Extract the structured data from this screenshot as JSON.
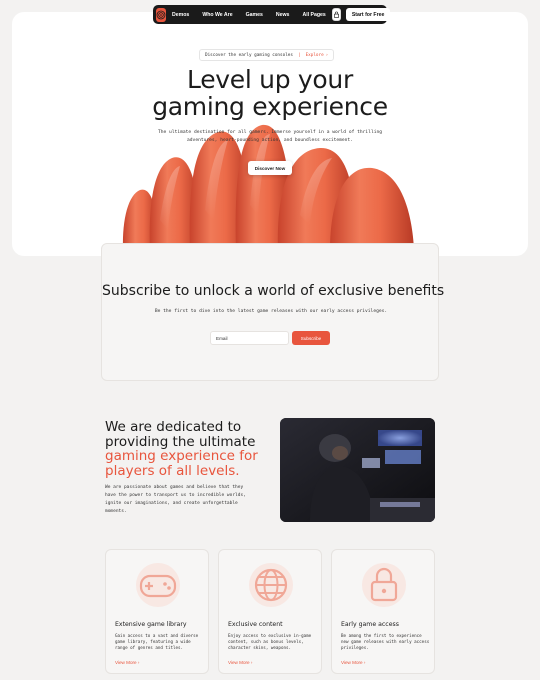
{
  "nav": {
    "links": [
      "Demos",
      "Who We Are",
      "Games",
      "News",
      "All Pages"
    ],
    "cta": "Start for Free"
  },
  "hero": {
    "pill_text": "Discover the early gaming consoles",
    "pill_sep": "|",
    "pill_link": "Explore",
    "pill_arrow": "›",
    "title_line1": "Level up your",
    "title_line2": "gaming experience",
    "subtitle": "The ultimate destination for all gamers. Immerse yourself in a world of thrilling adventures, heart-pounding action, and boundless excitement.",
    "button": "Discover Now"
  },
  "subscribe": {
    "title": "Subscribe to unlock a world of exclusive benefits",
    "text": "Be the first to dive into the latest game releases with our early access privileges.",
    "email_placeholder": "Email",
    "button": "Subscribe"
  },
  "dedicated": {
    "line1": "We are dedicated to",
    "line2": "providing the ultimate",
    "line3": "gaming experience for",
    "line4": "players of all levels.",
    "text": "We are passionate about games and believe that they have the power to transport us to incredible worlds, ignite our imaginations, and create unforgettable moments."
  },
  "features": [
    {
      "title": "Extensive game library",
      "desc": "Gain access to a vast and diverse game library, featuring a wide range of genres and titles.",
      "link": "View More ›",
      "icon": "gamepad-icon"
    },
    {
      "title": "Exclusive content",
      "desc": "Enjoy access to exclusive in-game content, such as bonus levels, character skins, weapons.",
      "link": "View More ›",
      "icon": "globe-icon"
    },
    {
      "title": "Early game access",
      "desc": "Be among the first to experience new game releases with early access privileges.",
      "link": "View More ›",
      "icon": "lock-icon"
    }
  ],
  "colors": {
    "accent": "#e8553d",
    "dark": "#1a1a1a",
    "background": "#f3f2f1"
  }
}
